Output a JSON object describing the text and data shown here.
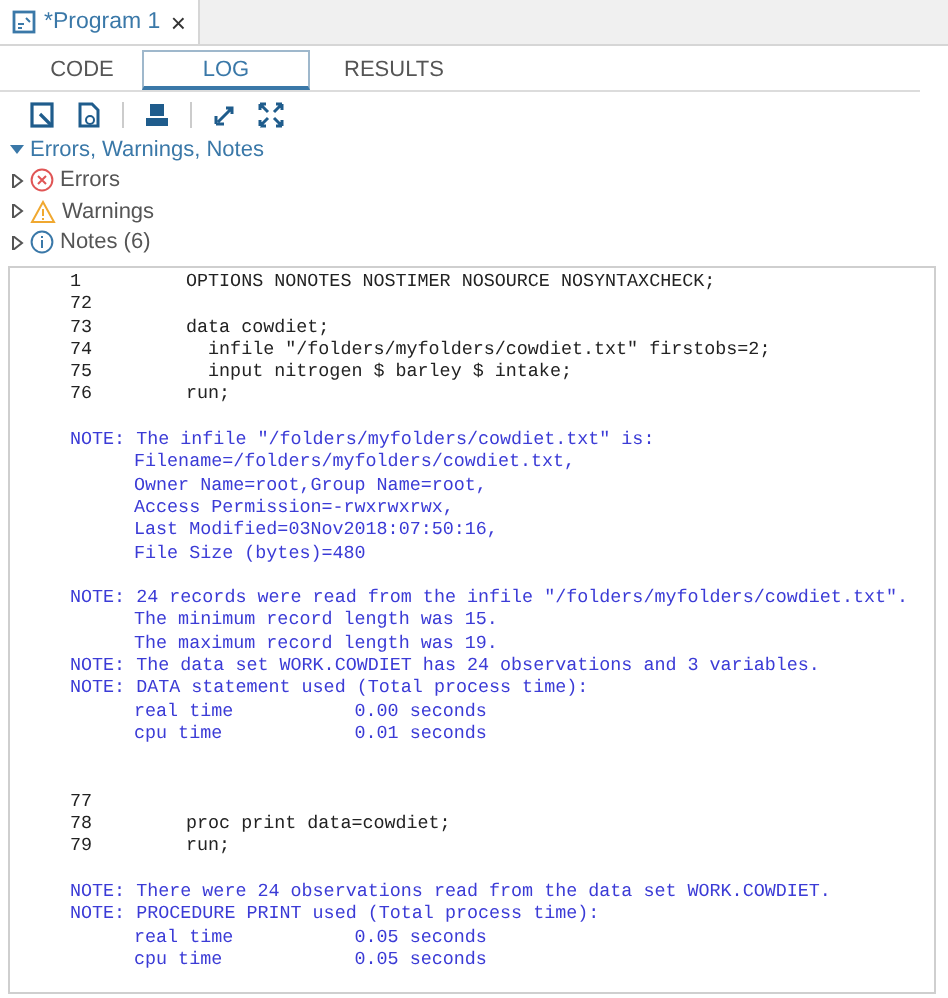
{
  "file_tab": {
    "title": "*Program 1",
    "close": "×"
  },
  "tabs": [
    {
      "label": "CODE",
      "selected": false
    },
    {
      "label": "LOG",
      "selected": true
    },
    {
      "label": "RESULTS",
      "selected": false
    }
  ],
  "tree": {
    "label": "Errors, Warnings, Notes",
    "expanded": true,
    "children": [
      {
        "label": "Errors",
        "kind": "error",
        "expanded": false
      },
      {
        "label": "Warnings",
        "kind": "warning",
        "expanded": false
      },
      {
        "label": "Notes (6)",
        "kind": "info",
        "expanded": false
      }
    ]
  },
  "log": [
    {
      "kind": "source",
      "number": "1",
      "text": "OPTIONS NONOTES NOSTIMER NOSOURCE NOSYNTAXCHECK;"
    },
    {
      "kind": "source",
      "number": "72"
    },
    {
      "kind": "source",
      "number": "73",
      "text": "data cowdiet;"
    },
    {
      "kind": "source",
      "number": "74",
      "text": "  infile \"/folders/myfolders/cowdiet.txt\" firstobs=2;"
    },
    {
      "kind": "source",
      "number": "75",
      "text": "  input nitrogen $ barley $ intake;"
    },
    {
      "kind": "source",
      "number": "76",
      "text": "run;"
    },
    {
      "kind": "gap"
    },
    {
      "kind": "note",
      "text": "NOTE: The infile \"/folders/myfolders/cowdiet.txt\" is:"
    },
    {
      "kind": "note-cont",
      "text": "Filename=/folders/myfolders/cowdiet.txt,"
    },
    {
      "kind": "note-cont",
      "text": "Owner Name=root,Group Name=root,"
    },
    {
      "kind": "note-cont",
      "text": "Access Permission=-rwxrwxrwx,"
    },
    {
      "kind": "note-cont",
      "text": "Last Modified=03Nov2018:07:50:16,"
    },
    {
      "kind": "note-cont",
      "text": "File Size (bytes)=480"
    },
    {
      "kind": "gap"
    },
    {
      "kind": "note",
      "text": "NOTE: 24 records were read from the infile \"/folders/myfolders/cowdiet.txt\"."
    },
    {
      "kind": "note-cont",
      "text": "The minimum record length was 15."
    },
    {
      "kind": "note-cont",
      "text": "The maximum record length was 19."
    },
    {
      "kind": "note",
      "text": "NOTE: The data set WORK.COWDIET has 24 observations and 3 variables."
    },
    {
      "kind": "note",
      "text": "NOTE: DATA statement used (Total process time):"
    },
    {
      "kind": "note-cont",
      "text": "real time           0.00 seconds"
    },
    {
      "kind": "note-cont",
      "text": "cpu time            0.01 seconds"
    },
    {
      "kind": "gap"
    },
    {
      "kind": "gap"
    },
    {
      "kind": "source",
      "number": "77"
    },
    {
      "kind": "source",
      "number": "78",
      "text": "proc print data=cowdiet;"
    },
    {
      "kind": "source",
      "number": "79",
      "text": "run;"
    },
    {
      "kind": "gap"
    },
    {
      "kind": "note",
      "text": "NOTE: There were 24 observations read from the data set WORK.COWDIET."
    },
    {
      "kind": "note",
      "text": "NOTE: PROCEDURE PRINT used (Total process time):"
    },
    {
      "kind": "note-cont",
      "text": "real time           0.05 seconds"
    },
    {
      "kind": "note-cont",
      "text": "cpu time            0.05 seconds"
    }
  ]
}
